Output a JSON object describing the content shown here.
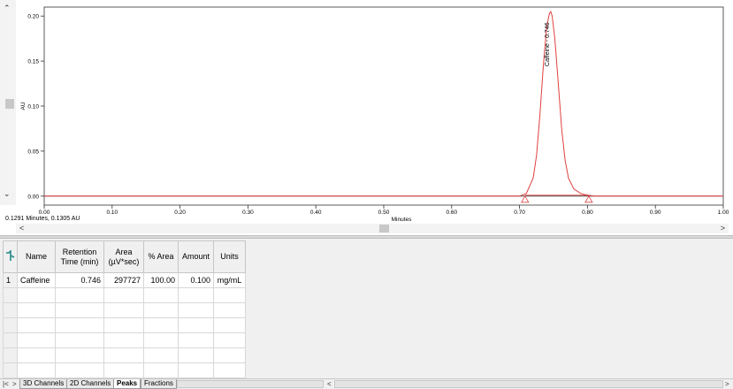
{
  "chart": {
    "y_axis_label": "AU",
    "x_axis_label": "Minutes",
    "cursor_readout": "0.1291 Minutes, 0.1305 AU",
    "peak_label": "Caffeine - 0.746",
    "trace_color": "#e04040",
    "baseline_color": "#e04040"
  },
  "chart_data": {
    "type": "line",
    "title": "",
    "xlabel": "Minutes",
    "ylabel": "AU",
    "xlim": [
      0.0,
      1.0
    ],
    "ylim": [
      -0.01,
      0.21
    ],
    "x_ticks": [
      "0.00",
      "0.10",
      "0.20",
      "0.30",
      "0.40",
      "0.50",
      "0.60",
      "0.70",
      "0.80",
      "0.90",
      "1.00"
    ],
    "y_ticks": [
      "0.00",
      "0.05",
      "0.10",
      "0.15",
      "0.20"
    ],
    "series": [
      {
        "x": [
          0.0,
          0.7,
          0.71,
          0.72,
          0.725,
          0.73,
          0.735,
          0.74,
          0.744,
          0.746,
          0.748,
          0.752,
          0.757,
          0.762,
          0.767,
          0.772,
          0.78,
          0.79,
          0.8,
          0.81,
          1.0
        ],
        "y": [
          0.0,
          0.0,
          0.003,
          0.02,
          0.045,
          0.09,
          0.145,
          0.188,
          0.203,
          0.205,
          0.2,
          0.175,
          0.125,
          0.075,
          0.04,
          0.02,
          0.008,
          0.003,
          0.001,
          0.0,
          0.0
        ]
      }
    ],
    "annotations": [
      {
        "text": "Caffeine - 0.746",
        "x": 0.746,
        "y": 0.205
      }
    ],
    "peak_markers": [
      {
        "x": 0.708,
        "y": 0.0
      },
      {
        "x": 0.802,
        "y": 0.0
      }
    ],
    "grid": false
  },
  "table": {
    "icon": "peak-icon",
    "columns": [
      "Name",
      "Retention Time (min)",
      "Area (µV*sec)",
      "% Area",
      "Amount",
      "Units"
    ],
    "rows": [
      {
        "index": "1",
        "name": "Caffeine",
        "retention_time": "0.746",
        "area": "297727",
        "pct_area": "100.00",
        "amount": "0.100",
        "units": "mg/mL"
      }
    ]
  },
  "tabs": [
    "3D Channels",
    "2D Channels",
    "Peaks",
    "Fractions"
  ],
  "active_tab": "Peaks"
}
